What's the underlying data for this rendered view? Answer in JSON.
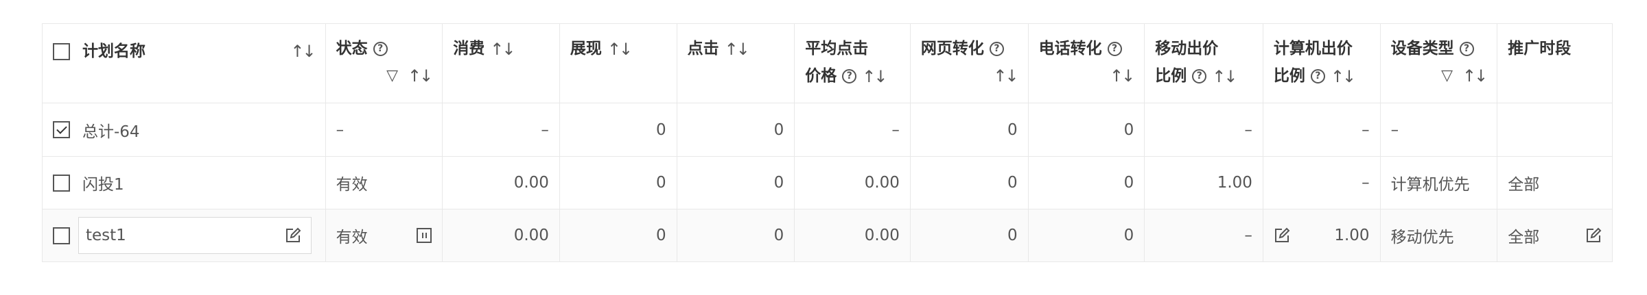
{
  "headers": {
    "name": "计划名称",
    "status": "状态",
    "cost": "消费",
    "impressions": "展现",
    "clicks": "点击",
    "avg_click_price_line1": "平均点击",
    "avg_click_price_line2": "价格",
    "web_conversion": "网页转化",
    "phone_conversion": "电话转化",
    "mobile_bid_line1": "移动出价",
    "mobile_bid_line2": "比例",
    "pc_bid_line1": "计算机出价",
    "pc_bid_line2": "比例",
    "device_type": "设备类型",
    "schedule": "推广时段"
  },
  "icons": {
    "sort": "sort-icon",
    "help": "help-icon",
    "filter": "filter-icon",
    "edit": "edit-icon",
    "pause": "pause-icon"
  },
  "rows": {
    "total": {
      "checked": true,
      "name": "总计-64",
      "status": "–",
      "cost": "–",
      "impressions": "0",
      "clicks": "0",
      "avg_click_price": "–",
      "web_conversion": "0",
      "phone_conversion": "0",
      "mobile_bid": "–",
      "pc_bid": "–",
      "device_type": "–",
      "schedule": ""
    },
    "flash": {
      "checked": false,
      "name": "闪投1",
      "status": "有效",
      "cost": "0.00",
      "impressions": "0",
      "clicks": "0",
      "avg_click_price": "0.00",
      "web_conversion": "0",
      "phone_conversion": "0",
      "mobile_bid": "1.00",
      "pc_bid": "–",
      "device_type": "计算机优先",
      "schedule": "全部"
    },
    "test": {
      "checked": false,
      "name": "test1",
      "status": "有效",
      "cost": "0.00",
      "impressions": "0",
      "clicks": "0",
      "avg_click_price": "0.00",
      "web_conversion": "0",
      "phone_conversion": "0",
      "mobile_bid": "–",
      "pc_bid": "1.00",
      "device_type": "移动优先",
      "schedule": "全部"
    }
  },
  "colors": {
    "border": "#e8e8e8",
    "text": "#333333",
    "muted_text": "#555555",
    "row_hover": "#fafafa"
  }
}
